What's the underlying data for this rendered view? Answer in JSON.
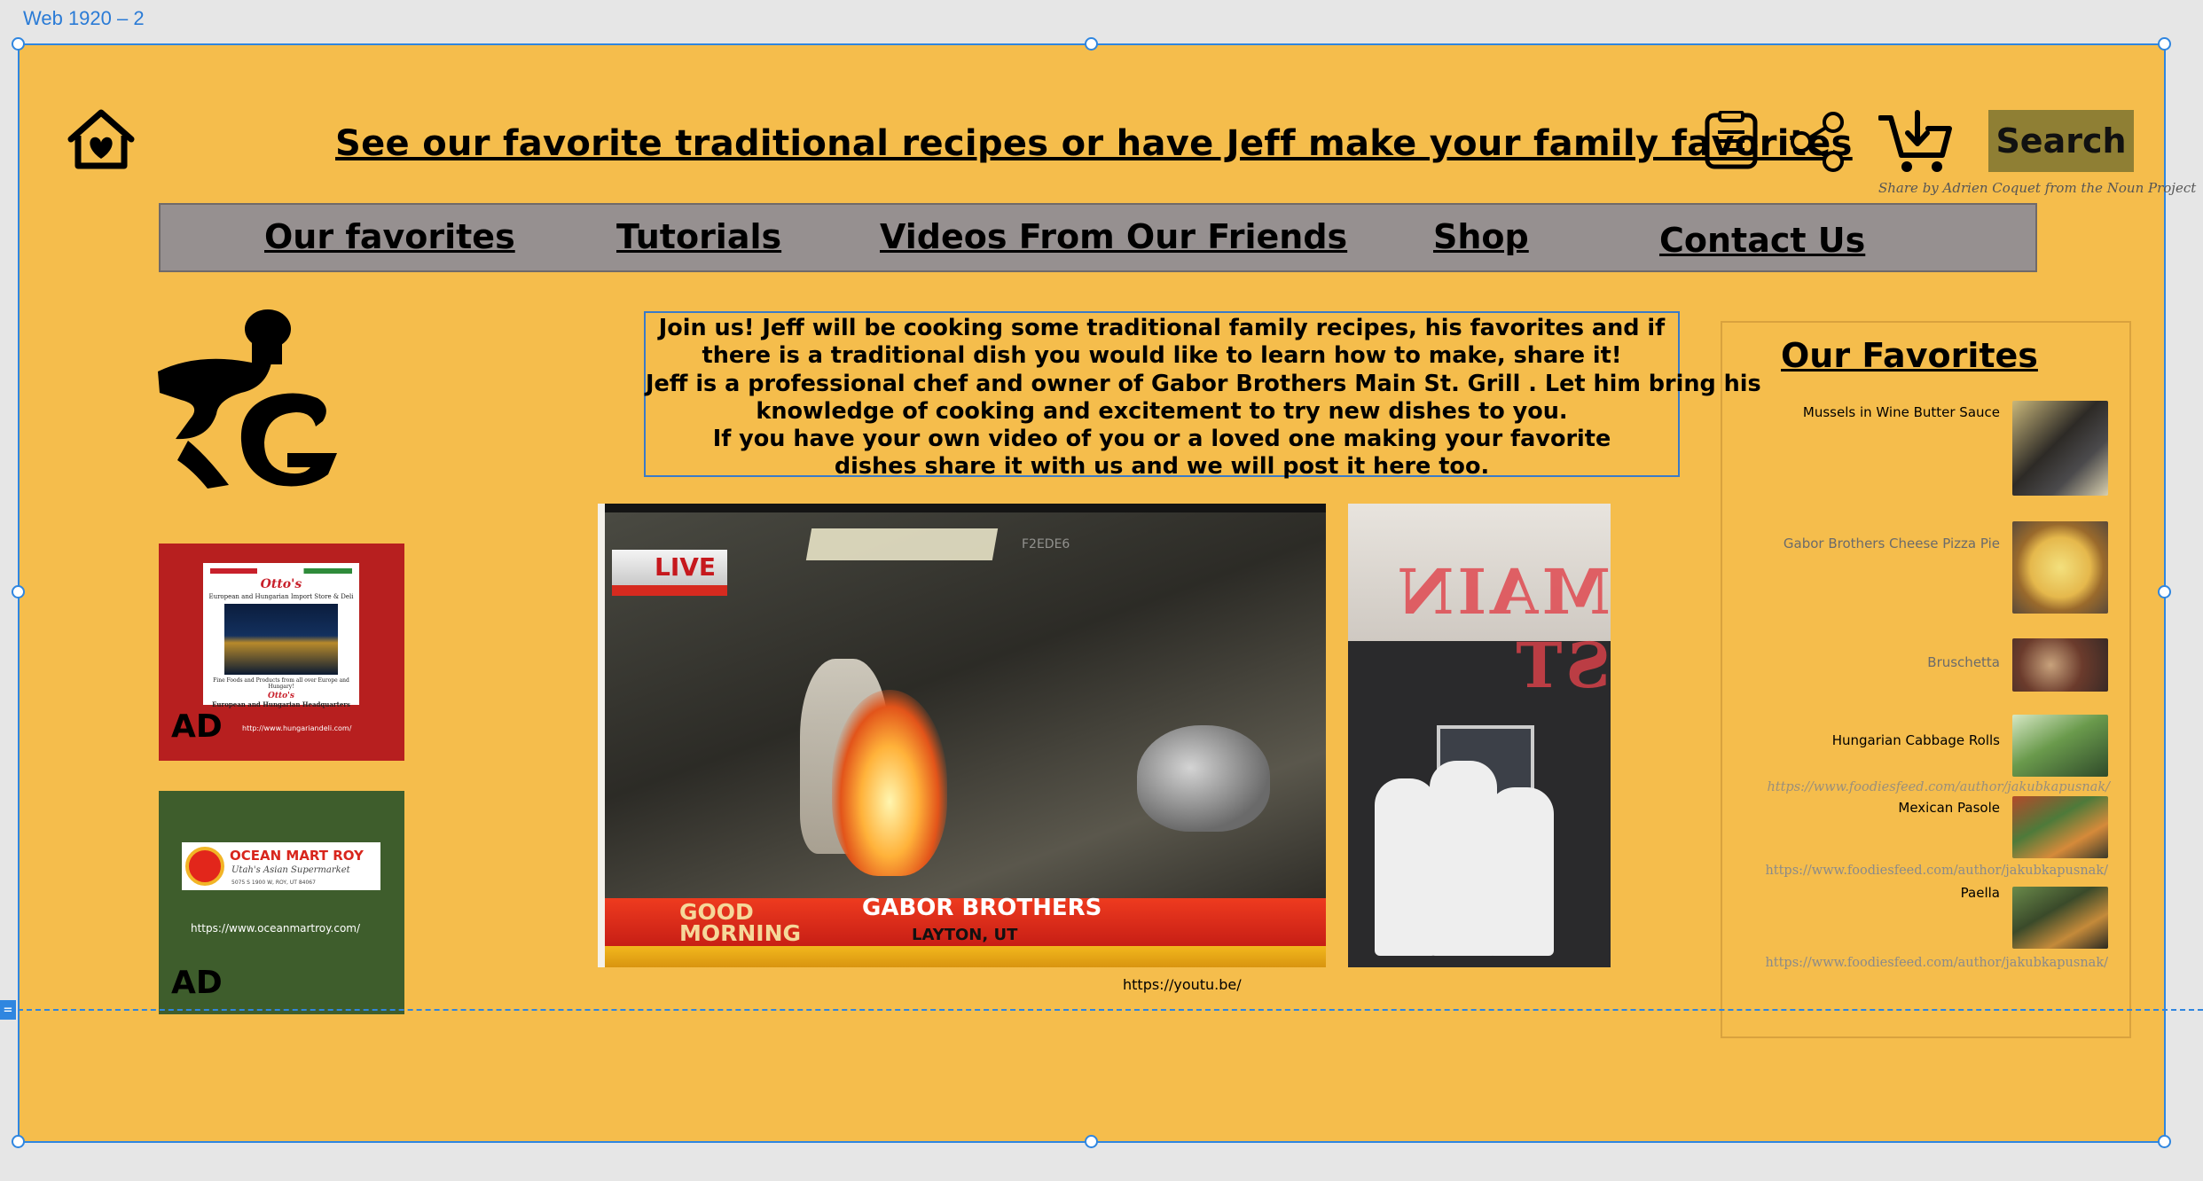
{
  "artboard": {
    "label": "Web 1920 – 2"
  },
  "header": {
    "headline": "See our favorite traditional recipes or have Jeff make your family favorites",
    "search_label": "Search",
    "icon_credit": "Share by Adrien Coquet from the Noun Project",
    "icons": [
      "home-heart-icon",
      "document-icon",
      "share-icon",
      "cart-icon"
    ]
  },
  "nav": {
    "items": [
      {
        "label": "Our favorites"
      },
      {
        "label": "Tutorials"
      },
      {
        "label": "Videos From Our Friends"
      },
      {
        "label": "Shop"
      },
      {
        "label": "Contact Us"
      }
    ]
  },
  "intro": {
    "lines": [
      "Join us! Jeff will be cooking some traditional family recipes, his favorites and if",
      "there is a traditional dish you would like to learn how to make, share it!",
      "Jeff is a professional chef and owner of Gabor Brothers Main St. Grill . Let him bring his",
      "knowledge of cooking and excitement to try new dishes to you.",
      "If you have your own video of you or a loved one making your favorite",
      "dishes share it with us and we will post it here too."
    ]
  },
  "ads": {
    "red": {
      "brand": "Otto's",
      "tagline": "European and Hungarian Import Store & Deli",
      "small_text": "Fine Foods and Products from all over Europe and Hungary!",
      "brand2": "Otto's",
      "tagline2": "European and Hungarian Headquarters",
      "label": "AD",
      "url": "http://www.hungariandeli.com/"
    },
    "green": {
      "brand": "OCEAN MART ROY",
      "script": "Utah's Asian Supermarket",
      "small_text": "5075 S 1900 W, ROY, UT 84067",
      "label": "AD",
      "url": "https://www.oceanmartroy.com/"
    }
  },
  "video": {
    "live_badge": "LIVE",
    "watermark": "F2EDE6",
    "show_line1": "GOOD",
    "show_line2": "MORNING",
    "caption_title": "GABOR BROTHERS",
    "caption_sub": "LAYTON, UT",
    "url": "https://youtu.be/"
  },
  "photo": {
    "sign_text": "MAIN ST"
  },
  "favorites": {
    "title": "Our Favorites",
    "items": [
      {
        "label": "Mussels in Wine Butter Sauce",
        "tone": "dark"
      },
      {
        "label": "Gabor Brothers Cheese Pizza Pie",
        "tone": "light"
      },
      {
        "label": "Bruschetta",
        "tone": "light"
      },
      {
        "label": "Hungarian Cabbage Rolls",
        "tone": "dark"
      },
      {
        "label": "Mexican Pasole",
        "tone": "dark"
      },
      {
        "label": "Paella",
        "tone": "dark"
      }
    ],
    "credits": [
      "https://www.foodiesfeed.com/author/jakubkapusnak/",
      "https://www.foodiesfeed.com/author/jakubkapusnak/",
      "https://www.foodiesfeed.com/author/jakubkapusnak/"
    ]
  },
  "colors": {
    "page_background": "#f5bd4c",
    "nav_background": "#969090",
    "search_button": "#8f7f34",
    "selection_blue": "#2f86e0",
    "ad_red": "#b71f1f",
    "ad_green": "#3e5d2c"
  }
}
